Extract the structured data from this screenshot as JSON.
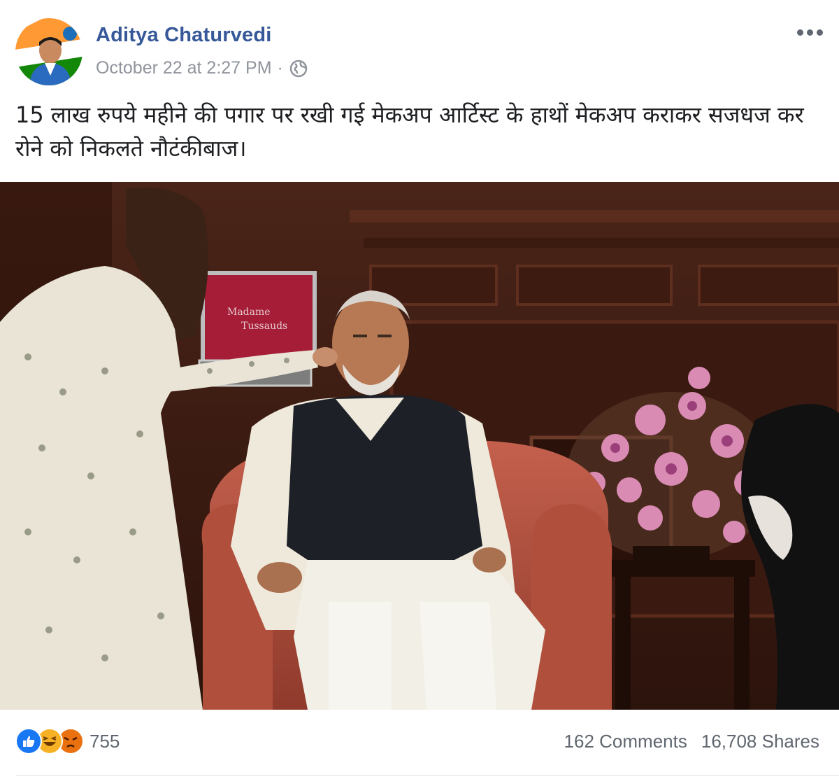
{
  "post": {
    "author": "Aditya Chaturvedi",
    "timestamp": "October 22 at 2:27 PM",
    "separator": "·",
    "privacy_icon": "globe-icon",
    "menu_icon": "more-options-icon",
    "text": "15 लाख रुपये महीने की पगार पर रखी गई मेकअप आर्टिस्ट के हाथों मेकअप कराकर सजधज कर रोने को निकलते नौटंकीबाज।"
  },
  "footer": {
    "reactions": [
      "like-icon",
      "haha-icon",
      "angry-icon"
    ],
    "reaction_count": "755",
    "comments": "162 Comments",
    "shares": "16,708 Shares"
  },
  "colors": {
    "author": "#365899",
    "meta": "#90949c",
    "like": "#1877f2",
    "haha": "#f7b125",
    "angry": "#e9710f"
  }
}
